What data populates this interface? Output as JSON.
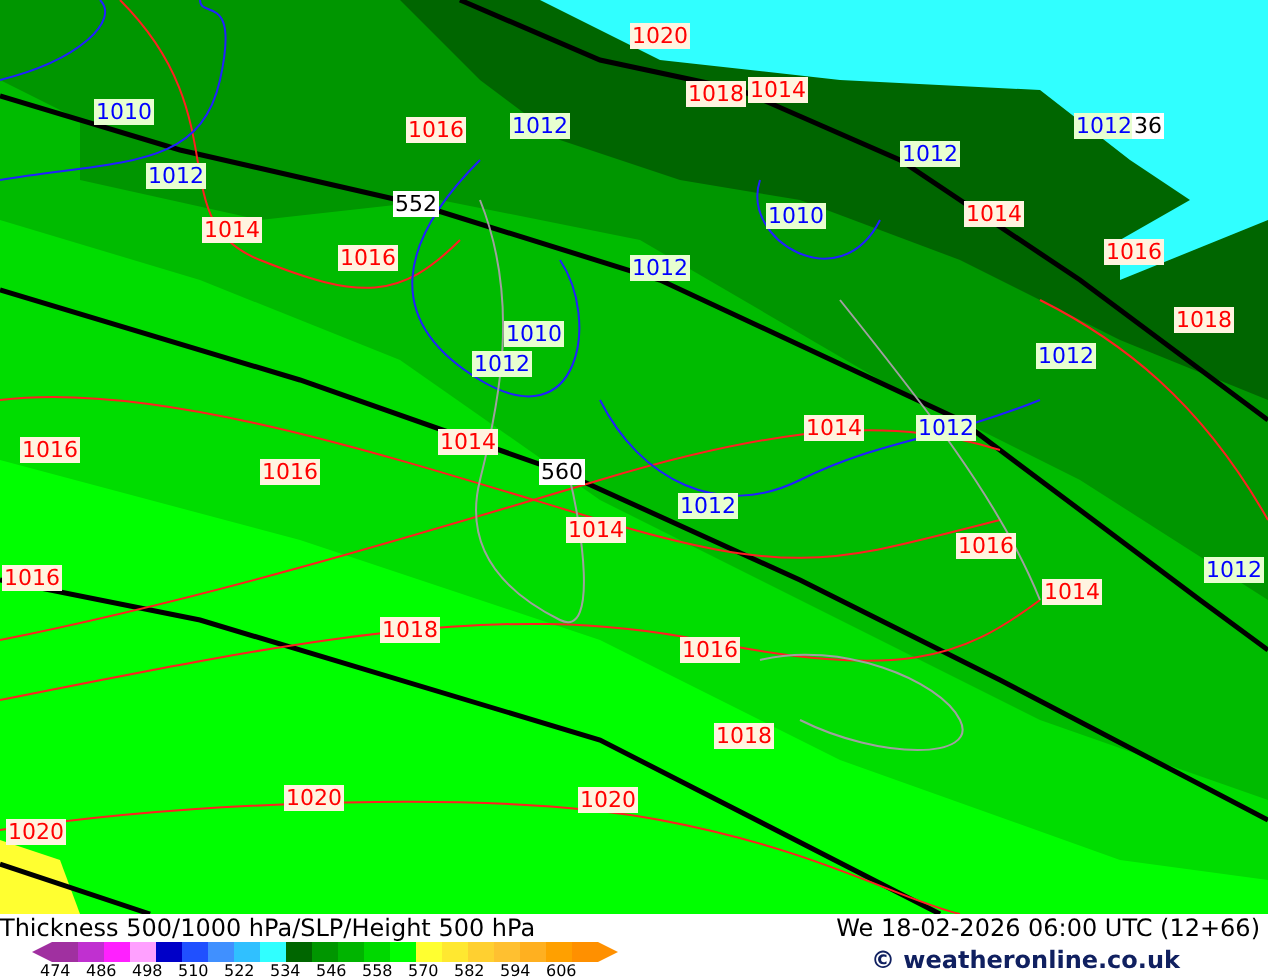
{
  "map": {
    "labels": [
      {
        "text": "1020",
        "color": "#ff0000"
      },
      {
        "text": "1018",
        "color": "#ff0000"
      },
      {
        "text": "1014",
        "color": "#ff0000"
      },
      {
        "text": "1010",
        "color": "#0000ff"
      },
      {
        "text": "1016",
        "color": "#ff0000"
      },
      {
        "text": "1012",
        "color": "#0000ff"
      },
      {
        "text": "1012",
        "color": "#0000ff"
      },
      {
        "text": "36",
        "color": "#000000"
      },
      {
        "text": "1012",
        "color": "#0000ff"
      },
      {
        "text": "1012",
        "color": "#0000ff"
      },
      {
        "text": "552",
        "color": "#000000"
      },
      {
        "text": "1010",
        "color": "#0000ff"
      },
      {
        "text": "1014",
        "color": "#ff0000"
      },
      {
        "text": "1014",
        "color": "#ff0000"
      },
      {
        "text": "1016",
        "color": "#ff0000"
      },
      {
        "text": "1012",
        "color": "#0000ff"
      },
      {
        "text": "1016",
        "color": "#ff0000"
      },
      {
        "text": "1010",
        "color": "#0000ff"
      },
      {
        "text": "1018",
        "color": "#ff0000"
      },
      {
        "text": "1012",
        "color": "#0000ff"
      },
      {
        "text": "1012",
        "color": "#0000ff"
      },
      {
        "text": "1016",
        "color": "#ff0000"
      },
      {
        "text": "1014",
        "color": "#ff0000"
      },
      {
        "text": "1014",
        "color": "#ff0000"
      },
      {
        "text": "1012",
        "color": "#0000ff"
      },
      {
        "text": "1016",
        "color": "#ff0000"
      },
      {
        "text": "560",
        "color": "#000000"
      },
      {
        "text": "1012",
        "color": "#0000ff"
      },
      {
        "text": "1014",
        "color": "#ff0000"
      },
      {
        "text": "1016",
        "color": "#ff0000"
      },
      {
        "text": "1016",
        "color": "#ff0000"
      },
      {
        "text": "1014",
        "color": "#ff0000"
      },
      {
        "text": "1012",
        "color": "#0000ff"
      },
      {
        "text": "1018",
        "color": "#ff0000"
      },
      {
        "text": "1016",
        "color": "#ff0000"
      },
      {
        "text": "1018",
        "color": "#ff0000"
      },
      {
        "text": "1020",
        "color": "#ff0000"
      },
      {
        "text": "1020",
        "color": "#ff0000"
      },
      {
        "text": "1020",
        "color": "#ff0000"
      }
    ]
  },
  "footer": {
    "title": "Thickness 500/1000 hPa/SLP/Height 500 hPa",
    "valid_time": "We 18-02-2026 06:00 UTC (12+66)",
    "copyright": "© weatheronline.co.uk",
    "scale": {
      "swatches": [
        {
          "color": "#a030a0"
        },
        {
          "color": "#c030d0"
        },
        {
          "color": "#ff20ff"
        },
        {
          "color": "#ffa0ff"
        },
        {
          "color": "#0000c8"
        },
        {
          "color": "#2050ff"
        },
        {
          "color": "#4090ff"
        },
        {
          "color": "#30c0ff"
        },
        {
          "color": "#30ffff"
        },
        {
          "color": "#006600"
        },
        {
          "color": "#009600"
        },
        {
          "color": "#00b400"
        },
        {
          "color": "#00d800"
        },
        {
          "color": "#00ff00"
        },
        {
          "color": "#ffff30"
        },
        {
          "color": "#ffe830"
        },
        {
          "color": "#ffd030"
        },
        {
          "color": "#ffc030"
        },
        {
          "color": "#ffb020"
        },
        {
          "color": "#ffa000"
        },
        {
          "color": "#ff9000"
        }
      ],
      "ticks": [
        "474",
        "486",
        "498",
        "510",
        "522",
        "534",
        "546",
        "558",
        "570",
        "582",
        "594",
        "606"
      ]
    }
  }
}
